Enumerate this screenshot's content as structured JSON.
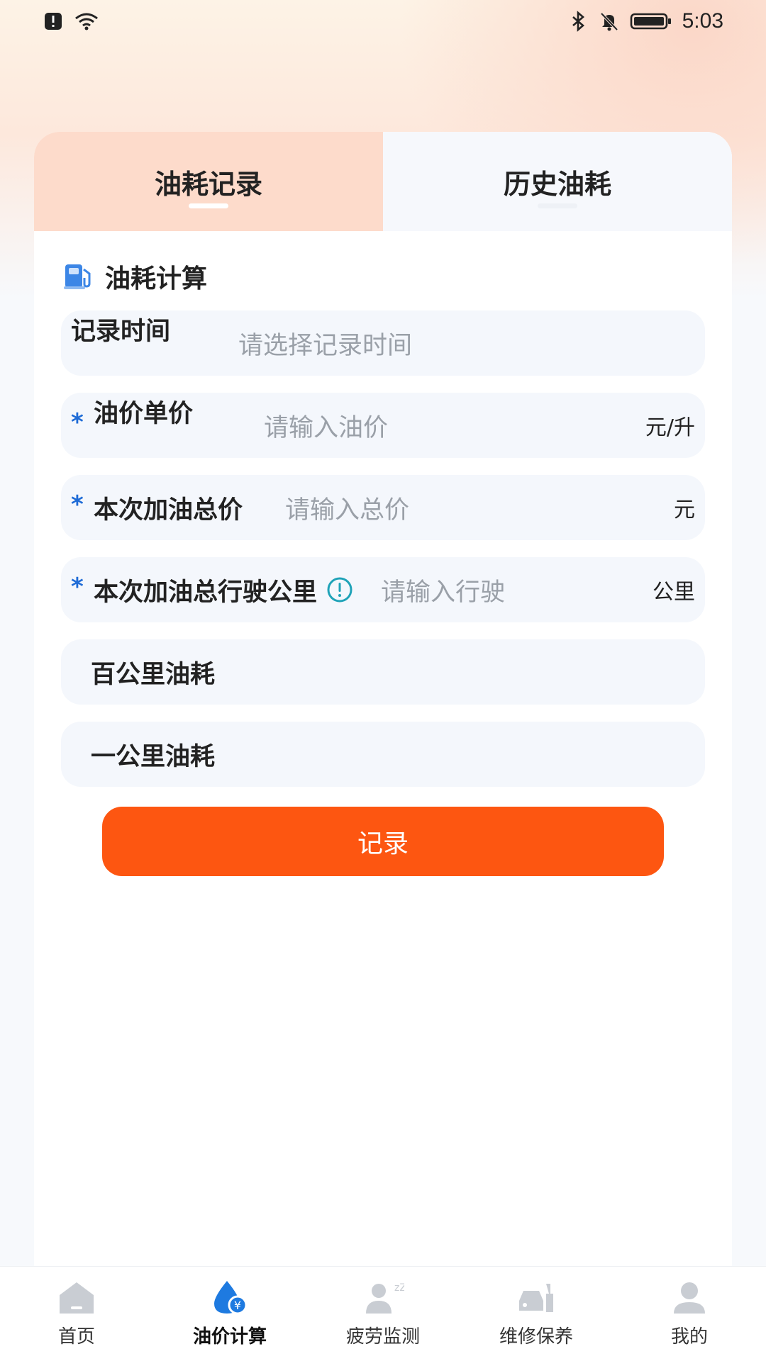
{
  "status_bar": {
    "time": "5:03"
  },
  "tabs": [
    {
      "label": "油耗记录",
      "active": true
    },
    {
      "label": "历史油耗",
      "active": false
    }
  ],
  "section": {
    "title": "油耗计算",
    "icon": "fuel-pump-icon"
  },
  "form": {
    "record_time": {
      "label": "记录时间",
      "placeholder": "请选择记录时间"
    },
    "unit_price": {
      "required_mark": "*",
      "label": "油价单价",
      "placeholder": "请输入油价",
      "unit": "元/升"
    },
    "total_price": {
      "required_mark": "*",
      "label": "本次加油总价",
      "placeholder": "请输入总价",
      "unit": "元"
    },
    "total_km": {
      "required_mark": "*",
      "label": "本次加油总行驶公里",
      "info_icon": "info-circle-icon",
      "placeholder": "请输入行驶",
      "unit": "公里"
    },
    "per_100km": {
      "label": "百公里油耗"
    },
    "per_km": {
      "label": "一公里油耗"
    }
  },
  "submit_label": "记录",
  "colors": {
    "accent": "#fd5611",
    "tab_active_bg": "#fddbcb",
    "required": "#1e6bd6",
    "info_icon": "#1fa3b8",
    "nav_active": "#1e7ae0"
  },
  "bottom_nav": [
    {
      "label": "首页",
      "icon": "home-icon"
    },
    {
      "label": "油价计算",
      "icon": "fuel-drop-yen-icon",
      "active": true
    },
    {
      "label": "疲劳监测",
      "icon": "sleepy-driver-icon"
    },
    {
      "label": "维修保养",
      "icon": "repair-tools-icon"
    },
    {
      "label": "我的",
      "icon": "user-icon"
    }
  ]
}
